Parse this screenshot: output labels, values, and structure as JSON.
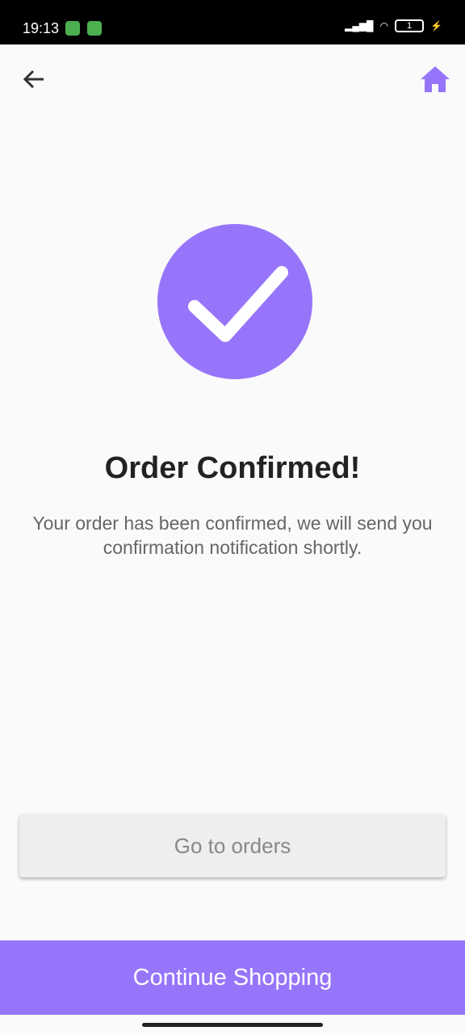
{
  "status": {
    "time": "19:13",
    "battery": "1"
  },
  "title": "Order Confirmed!",
  "message": "Your order has been confirmed, we will send you confirmation notification shortly.",
  "buttons": {
    "orders": "Go to orders",
    "continue": "Continue Shopping"
  },
  "colors": {
    "accent": "#9775fa"
  }
}
